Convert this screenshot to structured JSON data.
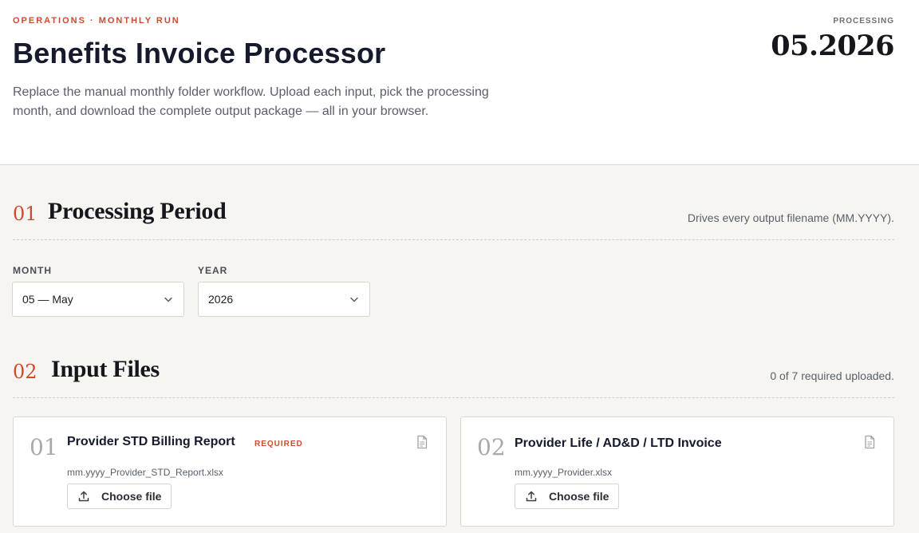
{
  "header": {
    "eyebrow": "OPERATIONS · MONTHLY RUN",
    "title": "Benefits Invoice Processor",
    "description": "Replace the manual monthly folder workflow. Upload each input, pick the processing month, and download the complete output package — all in your browser.",
    "period_label": "PROCESSING",
    "period_value": "05.2026"
  },
  "period_section": {
    "number": "01",
    "title": "Processing Period",
    "note": "Drives every output filename (MM.YYYY).",
    "month": {
      "label": "MONTH",
      "selected": "05 — May"
    },
    "year": {
      "label": "YEAR",
      "selected": "2026"
    }
  },
  "files_section": {
    "number": "02",
    "title": "Input Files",
    "note": "0 of 7 required uploaded.",
    "cards": [
      {
        "number": "01",
        "title": "Provider STD Billing Report",
        "badge": "REQUIRED",
        "filename": "mm.yyyy_Provider_STD_Report.xlsx",
        "button": "Choose file"
      },
      {
        "number": "02",
        "title": "Provider Life / AD&D / LTD Invoice",
        "filename": "mm.yyyy_Provider.xlsx",
        "button": "Choose file"
      }
    ]
  },
  "icons": {
    "select_arrow": "chevron-down-icon",
    "file": "document-icon",
    "upload": "upload-icon"
  },
  "colors": {
    "accent": "#cf4a2f",
    "page_bg": "#f6f5f1",
    "card_bg": "#ffffff",
    "heading": "#151a2c"
  }
}
